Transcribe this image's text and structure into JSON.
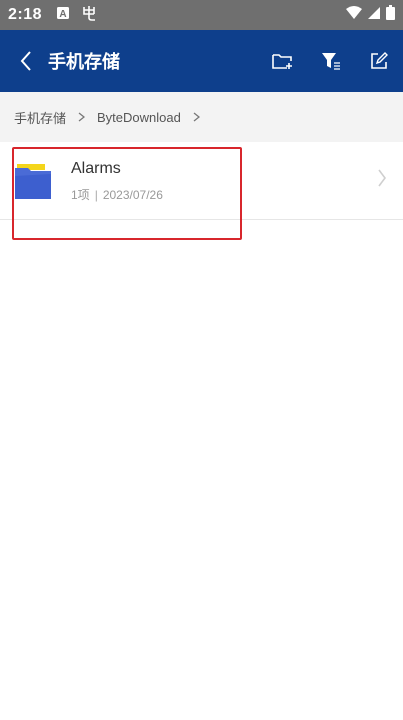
{
  "status_bar": {
    "time": "2:18",
    "left_icons": [
      "a-badge-icon",
      "bug-icon"
    ],
    "right_icons": [
      "wifi-icon",
      "signal-icon",
      "battery-icon"
    ]
  },
  "app_bar": {
    "title": "手机存储",
    "actions": [
      "new-folder-icon",
      "filter-icon",
      "edit-icon"
    ],
    "color": "#0e3f8c"
  },
  "breadcrumb": {
    "items": [
      "手机存储",
      "ByteDownload"
    ]
  },
  "files": [
    {
      "name": "Alarms",
      "count": "1项",
      "date": "2023/07/26",
      "icon": "folder-icon"
    }
  ],
  "highlight_color": "#d8262c"
}
